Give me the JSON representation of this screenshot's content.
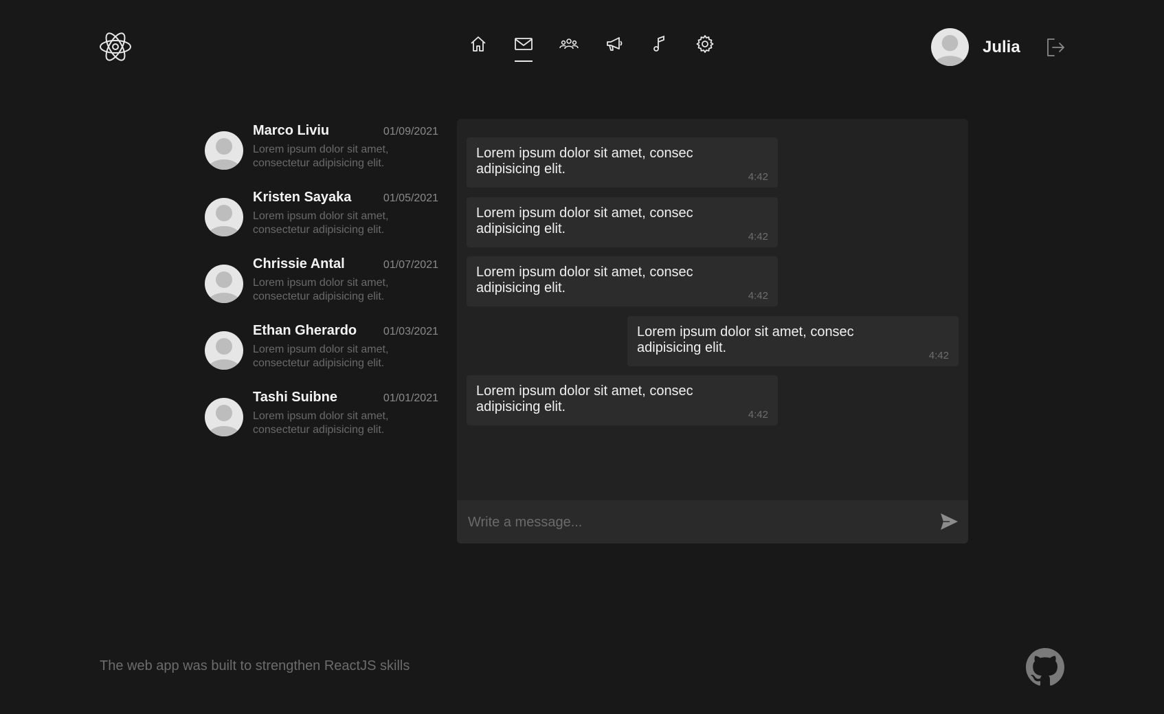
{
  "header": {
    "logo_icon": "atom-logo-icon",
    "nav": [
      {
        "icon": "home-icon",
        "active": false
      },
      {
        "icon": "mail-icon",
        "active": true
      },
      {
        "icon": "users-icon",
        "active": false
      },
      {
        "icon": "megaphone-icon",
        "active": false
      },
      {
        "icon": "music-icon",
        "active": false
      },
      {
        "icon": "gear-icon",
        "active": false
      }
    ],
    "user_name": "Julia",
    "logout_icon": "logout-icon"
  },
  "dialogs": [
    {
      "name": "Marco Liviu",
      "date": "01/09/2021",
      "preview": "Lorem ipsum dolor sit amet, consectetur adipisicing elit."
    },
    {
      "name": "Kristen Sayaka",
      "date": "01/05/2021",
      "preview": "Lorem ipsum dolor sit amet, consectetur adipisicing elit."
    },
    {
      "name": "Chrissie Antal",
      "date": "01/07/2021",
      "preview": "Lorem ipsum dolor sit amet, consectetur adipisicing elit."
    },
    {
      "name": "Ethan Gherardo",
      "date": "01/03/2021",
      "preview": "Lorem ipsum dolor sit amet, consectetur adipisicing elit."
    },
    {
      "name": "Tashi Suibne",
      "date": "01/01/2021",
      "preview": "Lorem ipsum dolor sit amet, consectetur adipisicing elit."
    }
  ],
  "messages": [
    {
      "text": "Lorem ipsum dolor sit amet, consec adipisicing elit.",
      "time": "4:42",
      "own": false
    },
    {
      "text": "Lorem ipsum dolor sit amet, consec adipisicing elit.",
      "time": "4:42",
      "own": false
    },
    {
      "text": "Lorem ipsum dolor sit amet, consec adipisicing elit.",
      "time": "4:42",
      "own": false
    },
    {
      "text": "Lorem ipsum dolor sit amet, consec adipisicing elit.",
      "time": "4:42",
      "own": true
    },
    {
      "text": "Lorem ipsum dolor sit amet, consec adipisicing elit.",
      "time": "4:42",
      "own": false
    }
  ],
  "composer": {
    "placeholder": "Write a message...",
    "send_icon": "send-icon"
  },
  "footer": {
    "text": "The web app was built to strengthen ReactJS skills",
    "github_icon": "github-icon"
  }
}
